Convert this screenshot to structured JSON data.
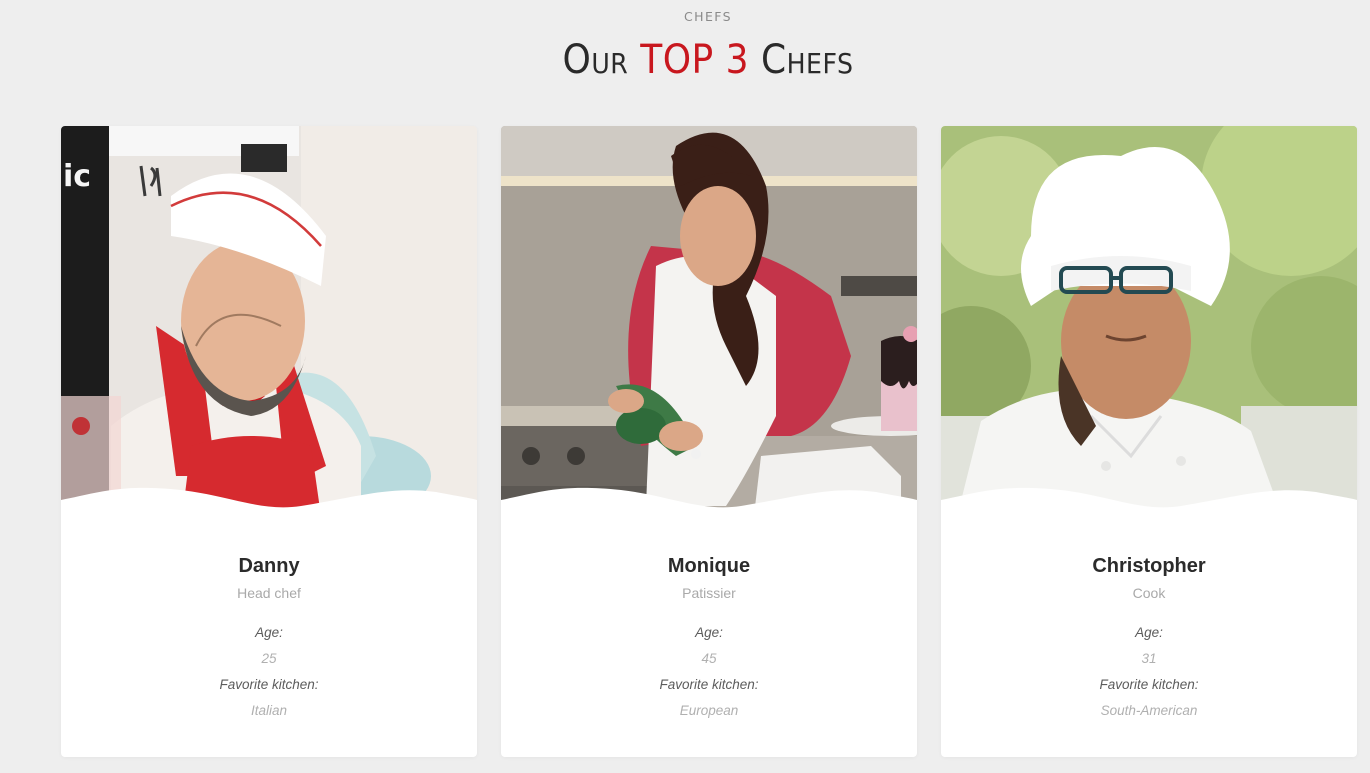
{
  "section": {
    "label": "CHEFS",
    "title_pre": "Our ",
    "title_accent": "TOP 3",
    "title_post": " Chefs",
    "accent_color": "#c8171e"
  },
  "details_labels": {
    "age": "Age:",
    "kitchen": "Favorite kitchen:"
  },
  "chefs": [
    {
      "name": "Danny",
      "role": "Head chef",
      "age": "25",
      "kitchen": "Italian",
      "photo_icon": "chef-photo-danny"
    },
    {
      "name": "Monique",
      "role": "Patissier",
      "age": "45",
      "kitchen": "European",
      "photo_icon": "chef-photo-monique"
    },
    {
      "name": "Christopher",
      "role": "Cook",
      "age": "31",
      "kitchen": "South-American",
      "photo_icon": "chef-photo-christopher"
    }
  ]
}
